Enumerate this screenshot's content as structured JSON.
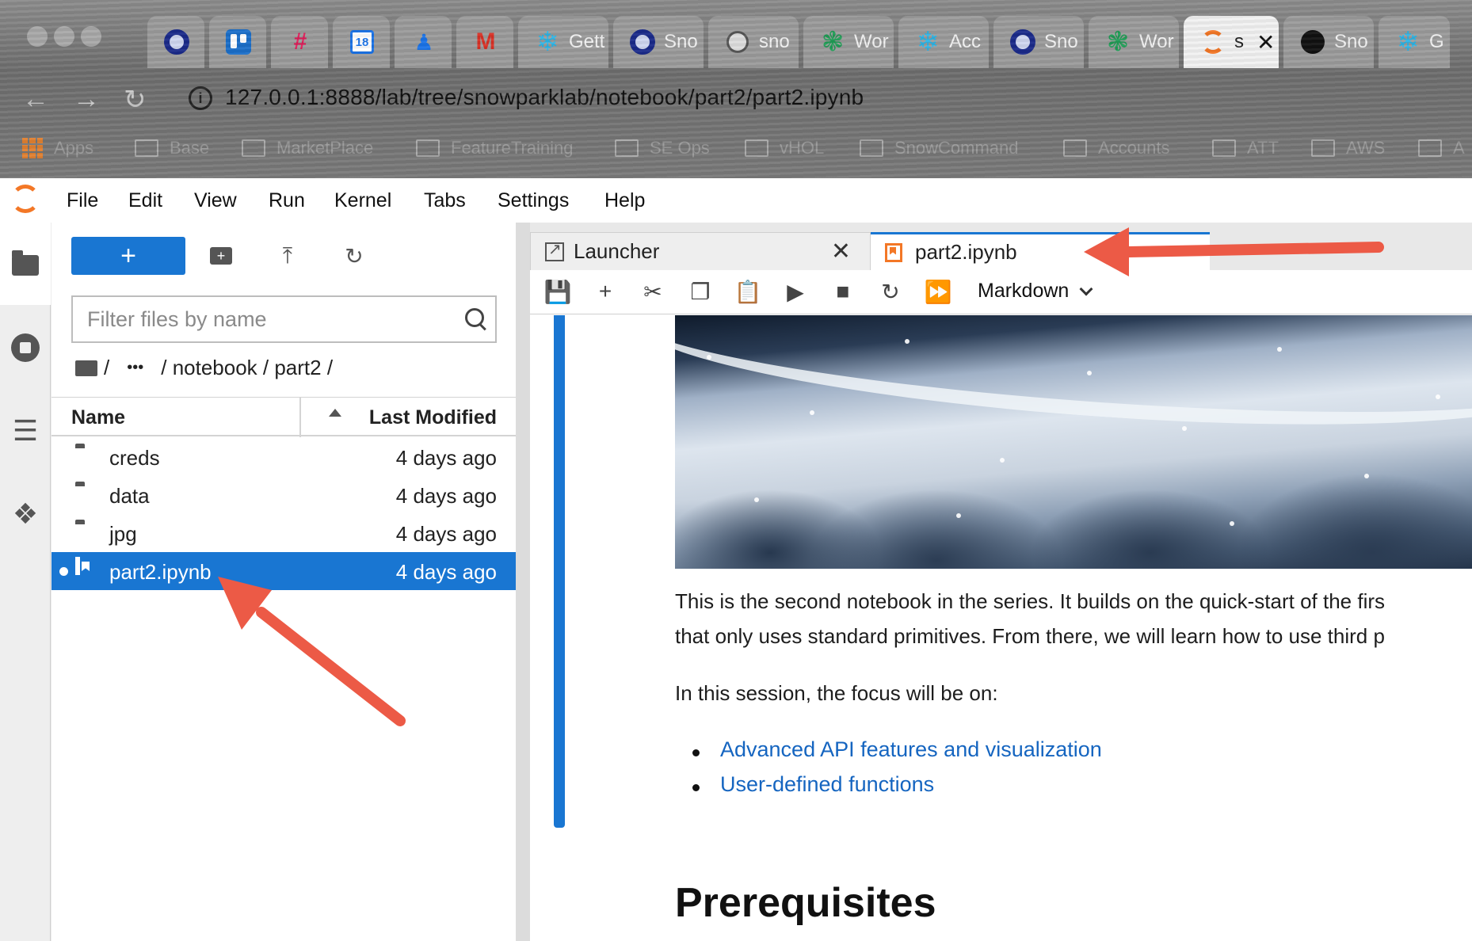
{
  "browser": {
    "tabs": [
      {
        "label": "",
        "icon": "ring-icon"
      },
      {
        "label": "",
        "icon": "trello-icon"
      },
      {
        "label": "",
        "icon": "slack-icon"
      },
      {
        "label": "",
        "icon": "calendar-icon",
        "badge": "18"
      },
      {
        "label": "",
        "icon": "people-icon"
      },
      {
        "label": "",
        "icon": "gmail-icon"
      },
      {
        "label": "Gett",
        "icon": "snowflake-icon"
      },
      {
        "label": "Sno",
        "icon": "ring-icon"
      },
      {
        "label": "sno",
        "icon": "globe-icon"
      },
      {
        "label": "Wor",
        "icon": "green-snowflake-icon"
      },
      {
        "label": "Acc",
        "icon": "snowflake-icon"
      },
      {
        "label": "Sno",
        "icon": "ring-icon"
      },
      {
        "label": "Wor",
        "icon": "green-snowflake-icon"
      },
      {
        "label": "s",
        "icon": "jupyter-icon",
        "active": true
      },
      {
        "label": "Sno",
        "icon": "github-icon"
      },
      {
        "label": "G",
        "icon": "snowflake-icon"
      }
    ],
    "url": "127.0.0.1:8888/lab/tree/snowparklab/notebook/part2/part2.ipynb",
    "bookmarks": [
      "Apps",
      "Base",
      "MarketPlace",
      "FeatureTraining",
      "SE Ops",
      "vHOL",
      "SnowCommand",
      "Accounts",
      "ATT",
      "AWS",
      "A"
    ]
  },
  "menu": {
    "items": [
      "File",
      "Edit",
      "View",
      "Run",
      "Kernel",
      "Tabs",
      "Settings",
      "Help"
    ]
  },
  "filebrowser": {
    "new_label": "+",
    "filter_placeholder": "Filter files by name",
    "breadcrumb": {
      "root": "/",
      "ellipsis": "•••",
      "path": "/ notebook / part2 /"
    },
    "columns": {
      "name": "Name",
      "modified": "Last Modified"
    },
    "rows": [
      {
        "name": "creds",
        "modified": "4 days ago",
        "type": "folder"
      },
      {
        "name": "data",
        "modified": "4 days ago",
        "type": "folder"
      },
      {
        "name": "jpg",
        "modified": "4 days ago",
        "type": "folder"
      },
      {
        "name": "part2.ipynb",
        "modified": "4 days ago",
        "type": "notebook",
        "selected": true,
        "running": true
      }
    ]
  },
  "main": {
    "tabs": [
      {
        "label": "Launcher",
        "close": "✕"
      },
      {
        "label": "part2.ipynb"
      }
    ],
    "cell_type": "Markdown",
    "notebook": {
      "para1_line1": "This is the second notebook in the series. It builds on the quick-start of the firs",
      "para1_line2": "that only uses standard primitives. From there, we will learn how to use third p",
      "para2": "In this session, the focus will be on:",
      "links": [
        "Advanced API features and visualization",
        "User-defined functions"
      ],
      "heading": "Prerequisites"
    }
  },
  "colors": {
    "accent": "#1976d2",
    "jupyter_orange": "#f37726",
    "link": "#1565c0",
    "arrow": "#ec5a46"
  }
}
